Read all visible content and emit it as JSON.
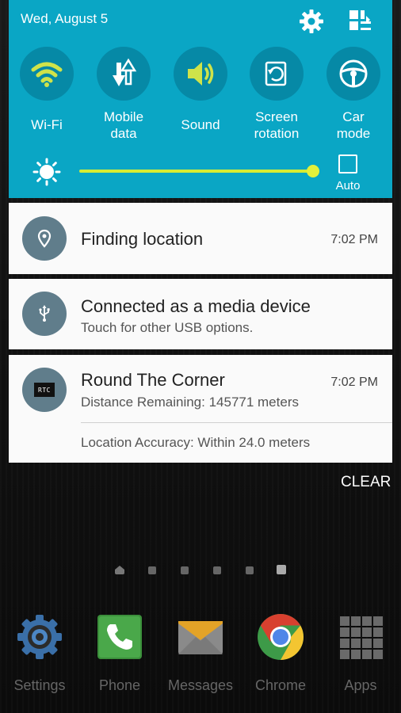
{
  "status": {
    "date": "Wed, August 5"
  },
  "quick_settings": {
    "tiles": [
      {
        "id": "wifi",
        "label": "Wi-Fi",
        "icon": "wifi-icon",
        "active": true
      },
      {
        "id": "mobile-data",
        "label": "Mobile\ndata",
        "icon": "mobile-data-icon",
        "active": false
      },
      {
        "id": "sound",
        "label": "Sound",
        "icon": "sound-icon",
        "active": true
      },
      {
        "id": "screen-rotation",
        "label": "Screen\nrotation",
        "icon": "screen-rotation-icon",
        "active": false
      },
      {
        "id": "car-mode",
        "label": "Car\nmode",
        "icon": "car-mode-icon",
        "active": false
      }
    ],
    "brightness": {
      "level_fraction": 1.0,
      "auto_label": "Auto",
      "auto_checked": false
    },
    "colors": {
      "panel": "#0aa6c5",
      "active_icon": "#cfe34a",
      "slider": "#d6ec33"
    }
  },
  "notifications": [
    {
      "title": "Finding location",
      "time": "7:02 PM",
      "icon": "location-pin-icon"
    },
    {
      "title": "Connected as a media device",
      "subtitle": "Touch for other USB options.",
      "icon": "usb-icon"
    },
    {
      "title": "Round The Corner",
      "subtitle": "Distance Remaining: 145771 meters",
      "time": "7:02 PM",
      "detail": "Location Accuracy: Within 24.0 meters",
      "icon": "rtc-app-icon",
      "icon_text": "RTC"
    }
  ],
  "clear_label": "CLEAR",
  "dock": [
    {
      "label": "Settings",
      "icon": "settings-icon"
    },
    {
      "label": "Phone",
      "icon": "phone-icon"
    },
    {
      "label": "Messages",
      "icon": "messages-icon"
    },
    {
      "label": "Chrome",
      "icon": "chrome-icon"
    },
    {
      "label": "Apps",
      "icon": "apps-grid-icon"
    }
  ]
}
